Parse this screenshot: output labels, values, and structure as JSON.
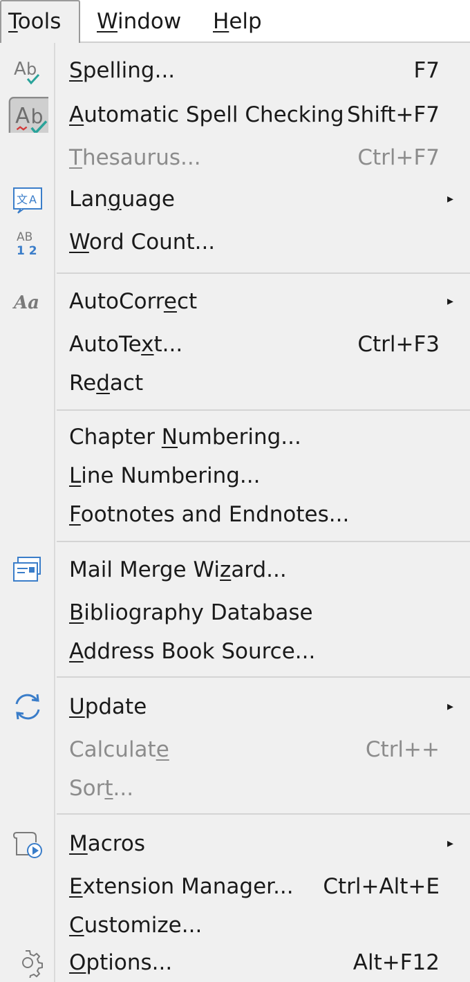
{
  "menubar": {
    "tools": {
      "pre": "",
      "u": "T",
      "post": "ools"
    },
    "window": {
      "pre": "",
      "u": "W",
      "post": "indow"
    },
    "help": {
      "pre": "",
      "u": "H",
      "post": "elp"
    }
  },
  "menu": {
    "spelling": {
      "pre": "",
      "u": "S",
      "post": "pelling...",
      "shortcut": "F7",
      "icon": "spelling-icon"
    },
    "auto_spell": {
      "pre": "",
      "u": "A",
      "post": "utomatic Spell Checking",
      "shortcut": "Shift+F7",
      "icon": "auto-spellcheck-icon",
      "checked": true
    },
    "thesaurus": {
      "pre": "",
      "u": "T",
      "post": "hesaurus...",
      "shortcut": "Ctrl+F7",
      "disabled": true
    },
    "language": {
      "pre": "Lan",
      "u": "g",
      "post": "uage",
      "submenu": true,
      "icon": "language-icon"
    },
    "word_count": {
      "pre": "",
      "u": "W",
      "post": "ord Count...",
      "icon": "word-count-icon"
    },
    "autocorrect": {
      "pre": "AutoCorr",
      "u": "e",
      "post": "ct",
      "submenu": true,
      "icon": "autocorrect-icon"
    },
    "autotext": {
      "pre": "AutoTe",
      "u": "x",
      "post": "t...",
      "shortcut": "Ctrl+F3"
    },
    "redact": {
      "pre": "Re",
      "u": "d",
      "post": "act"
    },
    "chapter_numbering": {
      "pre": "Chapter ",
      "u": "N",
      "post": "umbering..."
    },
    "line_numbering": {
      "pre": "",
      "u": "L",
      "post": "ine Numbering..."
    },
    "footnotes": {
      "pre": "",
      "u": "F",
      "post": "ootnotes and Endnotes..."
    },
    "mail_merge": {
      "pre": "Mail Merge Wi",
      "u": "z",
      "post": "ard...",
      "icon": "mail-merge-icon"
    },
    "bibliography": {
      "pre": "",
      "u": "B",
      "post": "ibliography Database"
    },
    "address_book": {
      "pre": "",
      "u": "A",
      "post": "ddress Book Source..."
    },
    "update": {
      "pre": "",
      "u": "U",
      "post": "pdate",
      "submenu": true,
      "icon": "update-icon"
    },
    "calculate": {
      "pre": "Calculat",
      "u": "e",
      "post": "",
      "shortcut": "Ctrl++",
      "disabled": true
    },
    "sort": {
      "pre": "Sor",
      "u": "t",
      "post": "...",
      "disabled": true
    },
    "macros": {
      "pre": "",
      "u": "M",
      "post": "acros",
      "submenu": true,
      "icon": "macros-icon"
    },
    "extension_manager": {
      "pre": "",
      "u": "E",
      "post": "xtension Manager...",
      "shortcut": "Ctrl+Alt+E"
    },
    "customize": {
      "pre": "",
      "u": "C",
      "post": "ustomize..."
    },
    "options": {
      "pre": "",
      "u": "O",
      "post": "ptions...",
      "shortcut": "Alt+F12",
      "icon": "gear-icon"
    }
  },
  "submenu_arrow": "▸",
  "colors": {
    "accent": "#3a7dc9",
    "disabled": "#8c8c8c",
    "check": "#2aa39a"
  }
}
